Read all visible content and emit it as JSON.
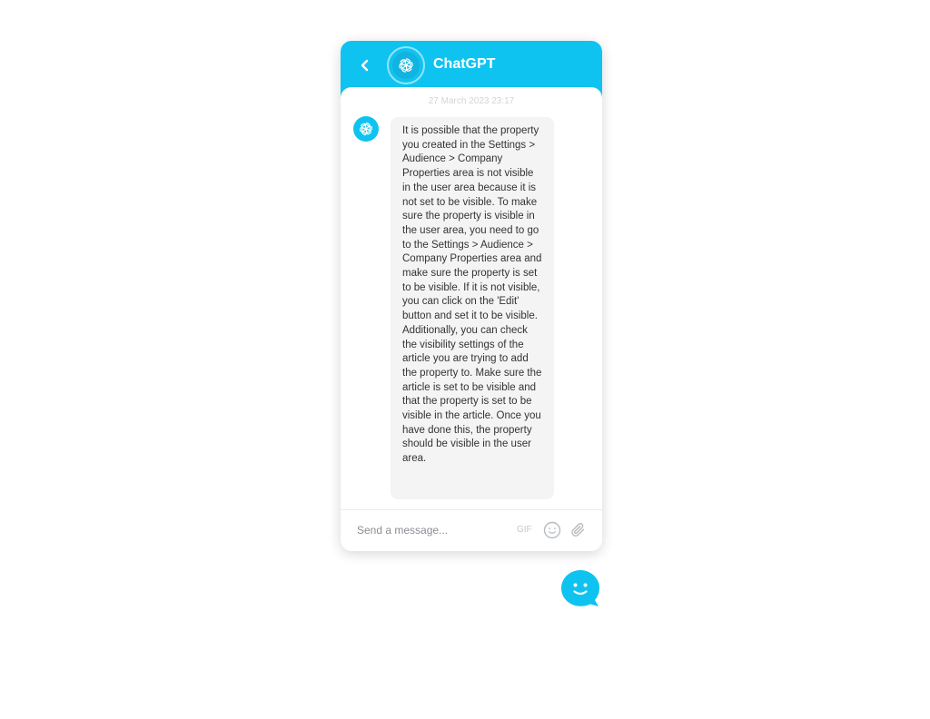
{
  "header": {
    "title": "ChatGPT",
    "back_icon": "chevron-left-icon",
    "avatar_icon": "openai-logo-icon"
  },
  "conversation": {
    "timestamp": "27 March 2023 23:17",
    "messages": [
      {
        "sender_avatar_icon": "openai-logo-icon",
        "text": "It is possible that the property you created in the Settings > Audience > Company Properties area is not visible in the user area because it is not set to be visible. To make sure the property is visible in the user area, you need to go to the Settings > Audience > Company Properties area and make sure the property is set to be visible. If it is not visible, you can click on the 'Edit' button and set it to be visible. Additionally, you can check the visibility settings of the article you are trying to add the property to. Make sure the article is set to be visible and that the property is set to be visible in the article. Once you have done this, the property should be visible in the user area."
      }
    ]
  },
  "composer": {
    "placeholder": "Send a message...",
    "value": "",
    "gif_label": "GIF",
    "emoji_icon": "emoji-smiley-icon",
    "attach_icon": "paperclip-icon"
  },
  "launcher": {
    "icon": "chat-bubble-smiley-icon"
  },
  "colors": {
    "brand": "#0fc3f0",
    "bubble_bg": "#f4f4f4",
    "text": "#333333",
    "muted": "#8a8d93"
  }
}
